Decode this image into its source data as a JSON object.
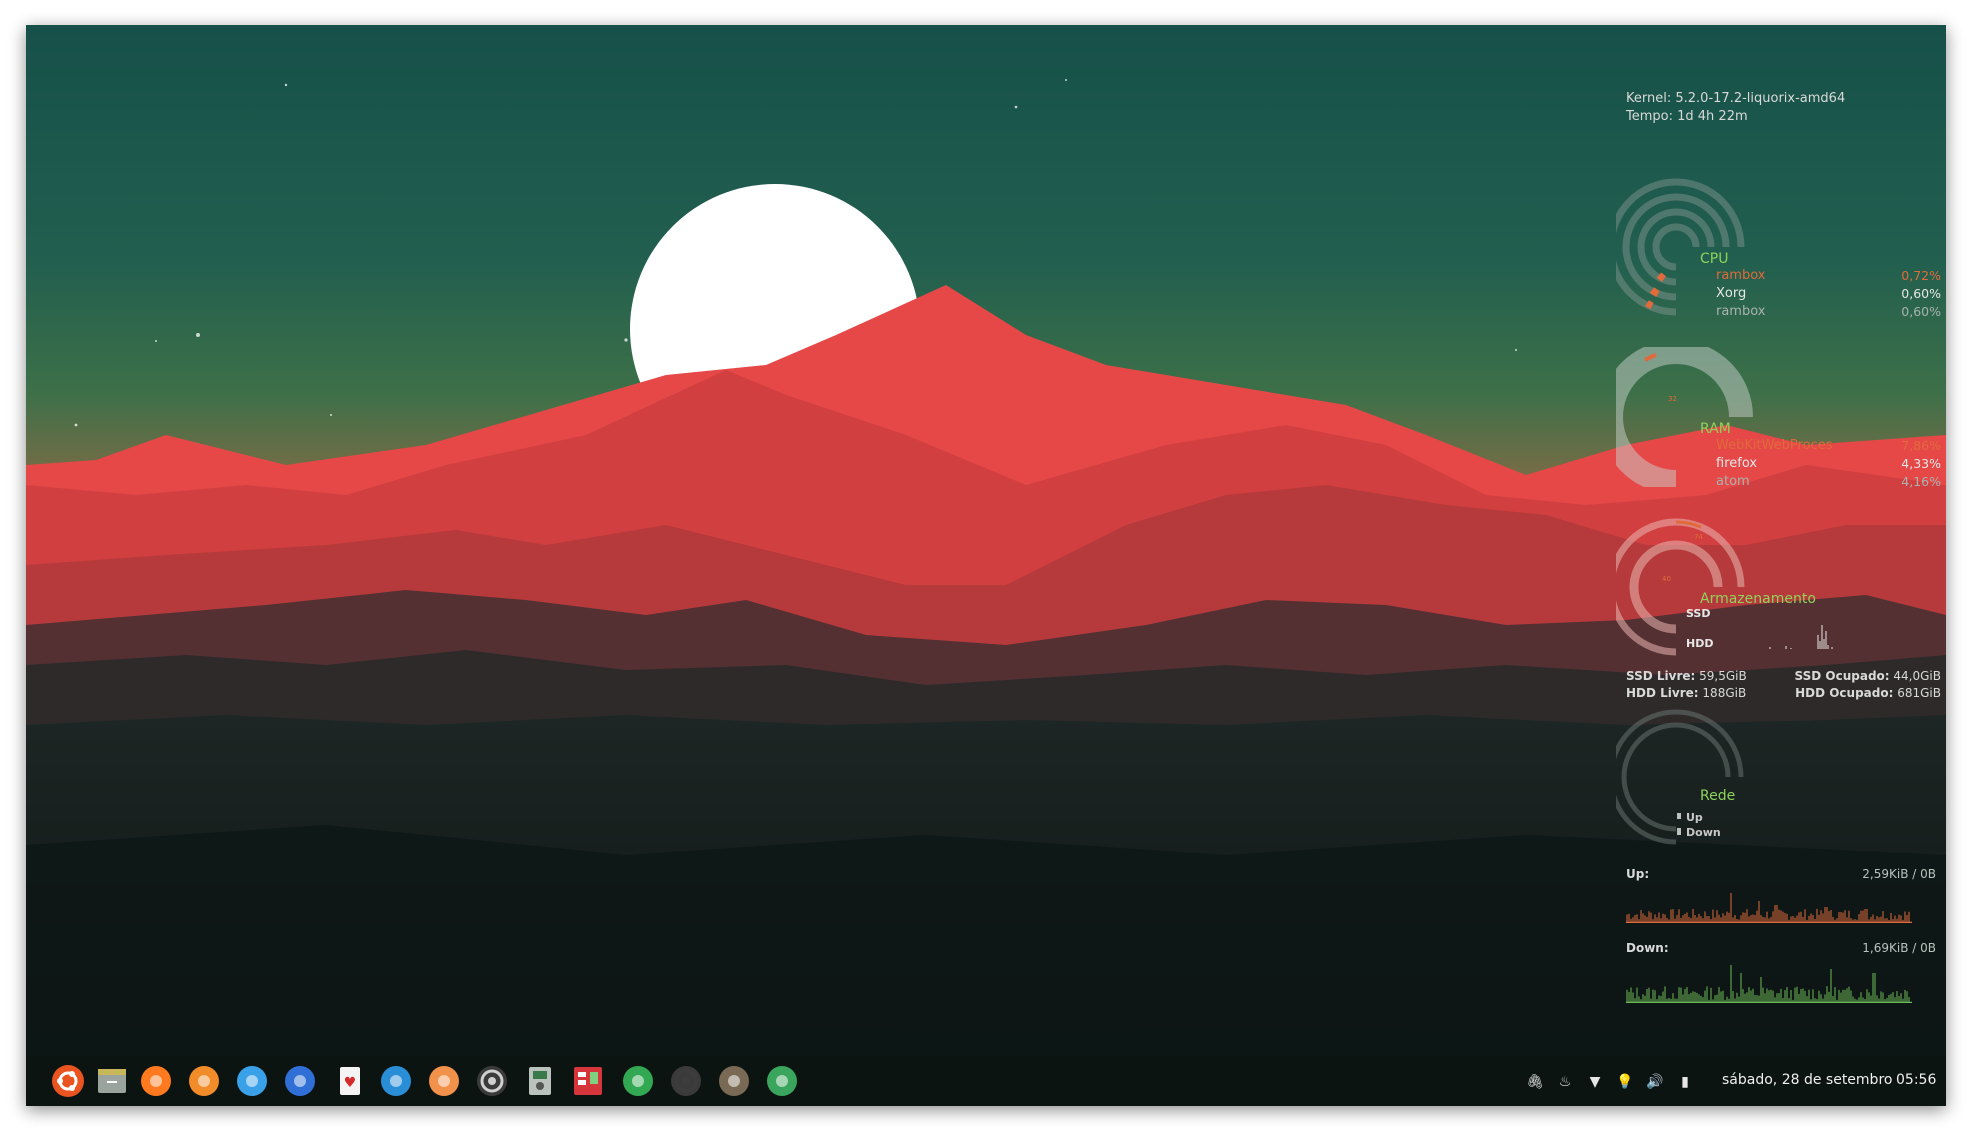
{
  "system": {
    "kernel_label": "Kernel:",
    "kernel_value": "5.2.0-17.2-liquorix-amd64",
    "uptime_label": "Tempo:",
    "uptime_value": "1d 4h 22m"
  },
  "cpu": {
    "title": "CPU",
    "processes": [
      {
        "name": "rambox",
        "value": "0,72%"
      },
      {
        "name": "Xorg",
        "value": "0,60%"
      },
      {
        "name": "rambox",
        "value": "0,60%"
      }
    ]
  },
  "ram": {
    "title": "RAM",
    "ring_label": "32",
    "processes": [
      {
        "name": "WebKitWebProces",
        "value": "7,86%"
      },
      {
        "name": "firefox",
        "value": "4,33%"
      },
      {
        "name": "atom",
        "value": "4,16%"
      }
    ]
  },
  "storage": {
    "title": "Armazenamento",
    "ring_label_outer": "74",
    "ring_label_inner": "40",
    "ssd_label": "SSD",
    "hdd_label": "HDD",
    "ssd_free_label": "SSD Livre:",
    "ssd_free_value": "59,5GiB",
    "ssd_used_label": "SSD Ocupado:",
    "ssd_used_value": "44,0GiB",
    "hdd_free_label": "HDD Livre:",
    "hdd_free_value": "188GiB",
    "hdd_used_label": "HDD Ocupado:",
    "hdd_used_value": "681GiB"
  },
  "network": {
    "title": "Rede",
    "up_ring_label": "Up",
    "down_ring_label": "Down",
    "up_label": "Up:",
    "up_value": "2,59KiB / 0B",
    "down_label": "Down:",
    "down_value": "1,69KiB / 0B"
  },
  "taskbar": {
    "apps": [
      {
        "name": "ubuntu-menu-icon",
        "color": "#e95420"
      },
      {
        "name": "file-manager-icon",
        "color": "#9aa39d"
      },
      {
        "name": "firefox-icon",
        "color": "#ff7a1f"
      },
      {
        "name": "rss-reader-icon",
        "color": "#f28c28"
      },
      {
        "name": "twitter-client-icon",
        "color": "#3aa0e8"
      },
      {
        "name": "dictionary-icon",
        "color": "#2f6fd6"
      },
      {
        "name": "solitaire-icon",
        "color": "#f4f4f4"
      },
      {
        "name": "steam-icon",
        "color": "#2a8ed6"
      },
      {
        "name": "mail-client-icon",
        "color": "#f2914a"
      },
      {
        "name": "disk-utility-icon",
        "color": "#cfcfcf"
      },
      {
        "name": "system-monitor-icon",
        "color": "#b9c2bc"
      },
      {
        "name": "task-manager-icon",
        "color": "#d6353c"
      },
      {
        "name": "maps-icon",
        "color": "#33a852"
      },
      {
        "name": "davinci-resolve-icon",
        "color": "#3d3d3d"
      },
      {
        "name": "gimp-icon",
        "color": "#7a6a55"
      },
      {
        "name": "atom-icon",
        "color": "#3aa55d"
      }
    ],
    "tray": [
      {
        "name": "clip-icon",
        "glyph": "🖇"
      },
      {
        "name": "notification-icon",
        "glyph": "♨"
      },
      {
        "name": "wifi-icon",
        "glyph": "▼"
      },
      {
        "name": "bulb-icon",
        "glyph": "💡"
      },
      {
        "name": "volume-icon",
        "glyph": "🔊"
      },
      {
        "name": "battery-icon",
        "glyph": "▮"
      }
    ],
    "date": "sábado, 28 de setembro",
    "time": "05:56"
  },
  "colors": {
    "sky_top": "#17524a",
    "sky_mid": "#2e6b50",
    "sky_low": "#8a6b44",
    "sun": "#ffffff",
    "mountain_red": "#e54646",
    "mountain_red_dark": "#b53a3b",
    "hills_dark": "#3a2628",
    "ground": "#0f1a18",
    "accent_green": "#8fd35b",
    "accent_orange": "#e06a3a"
  }
}
